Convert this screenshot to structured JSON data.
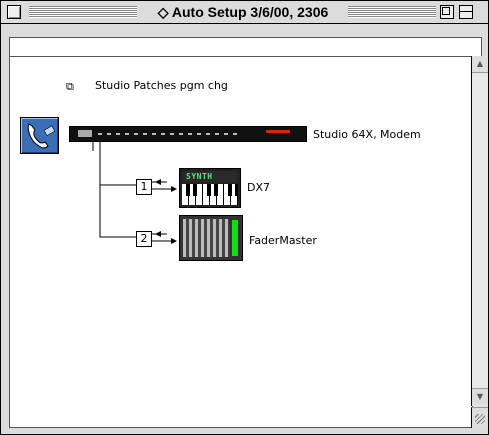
{
  "window": {
    "title": "◇ Auto Setup 3/6/00, 2306"
  },
  "document": {
    "name": "Studio Patches pgm chg"
  },
  "interface": {
    "label": "Studio 64X, Modem",
    "rack_text": ""
  },
  "devices": [
    {
      "port": "1",
      "name": "DX7",
      "display_text": "SYNTH"
    },
    {
      "port": "2",
      "name": "FaderMaster"
    }
  ],
  "icons": {
    "close": "close-box-icon",
    "zoom": "zoom-box-icon",
    "collapse": "collapse-box-icon",
    "document": "document-icon",
    "modem": "telephone-modem-icon",
    "scroll_up": "scroll-up-arrow-icon",
    "scroll_down": "scroll-down-arrow-icon",
    "grow": "grow-box-icon"
  },
  "colors": {
    "window_bg": "#dcdcdc",
    "modem_icon": "#3a6fb8",
    "synth_display": "#5ee27a"
  }
}
